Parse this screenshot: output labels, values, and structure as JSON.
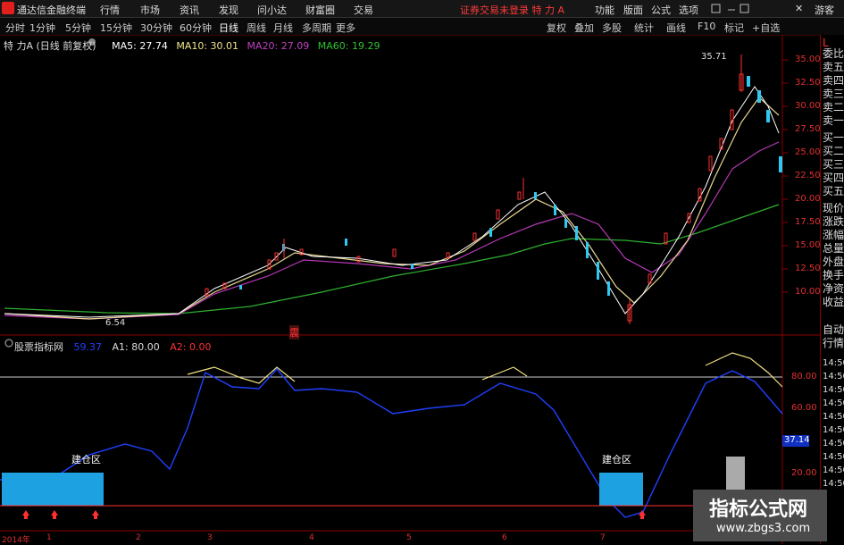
{
  "app": {
    "title": "通达信金融终端"
  },
  "menu": [
    "行情",
    "市场",
    "资讯",
    "发现",
    "问小达",
    "财富圈",
    "交易"
  ],
  "notice": "证券交易未登录  特 力 A",
  "top_right": [
    "功能",
    "版面",
    "公式",
    "选项"
  ],
  "guest": "游客",
  "periods": [
    "分时",
    "1分钟",
    "5分钟",
    "15分钟",
    "30分钟",
    "60分钟",
    "日线",
    "周线",
    "月线",
    "多周期",
    "更多"
  ],
  "active_period": "日线",
  "tools": [
    "复权",
    "叠加",
    "多股",
    "统计",
    "画线",
    "F10",
    "标记",
    "+自选"
  ],
  "main_chart": {
    "title": "特 力A (日线 前复权)",
    "ma": [
      {
        "label": "MA5: 27.74",
        "color": "#ffffff"
      },
      {
        "label": "MA10: 30.01",
        "color": "#f0e68c"
      },
      {
        "label": "MA20: 27.09",
        "color": "#c040c0"
      },
      {
        "label": "MA60: 19.29",
        "color": "#30c030"
      }
    ],
    "high_label": "35.71",
    "low_label": "6.54",
    "marker": "震",
    "yticks": [
      "35.00",
      "32.50",
      "30.00",
      "27.50",
      "25.00",
      "22.50",
      "20.00",
      "17.50",
      "15.00",
      "12.50",
      "10.00"
    ]
  },
  "sub_chart": {
    "title": "股票指标网",
    "value_label": "59.37",
    "a1": "A1: 80.00",
    "a2": "A2: 0.00",
    "yticks": [
      "80.00",
      "60.00",
      "40.00",
      "20.00"
    ],
    "current": "37.14",
    "zone_label": "建仓区"
  },
  "right_panel": [
    "L",
    "委比",
    "卖五",
    "卖四",
    "卖三",
    "卖二",
    "卖一",
    "买一",
    "买二",
    "买三",
    "买四",
    "买五",
    "现价",
    "涨跌",
    "涨幅",
    "总量",
    "外盘",
    "换手",
    "净资",
    "收益",
    "自动",
    "行情",
    "14:50",
    "14:50",
    "14:50",
    "14:50",
    "14:50",
    "14:50",
    "14:50",
    "14:50",
    "14:50",
    "14:50"
  ],
  "xaxis": [
    "2014年",
    "1",
    "2",
    "3",
    "4",
    "5",
    "6",
    "7"
  ],
  "watermark": {
    "title": "指标公式网",
    "url": "www.zbgs3.com"
  }
}
